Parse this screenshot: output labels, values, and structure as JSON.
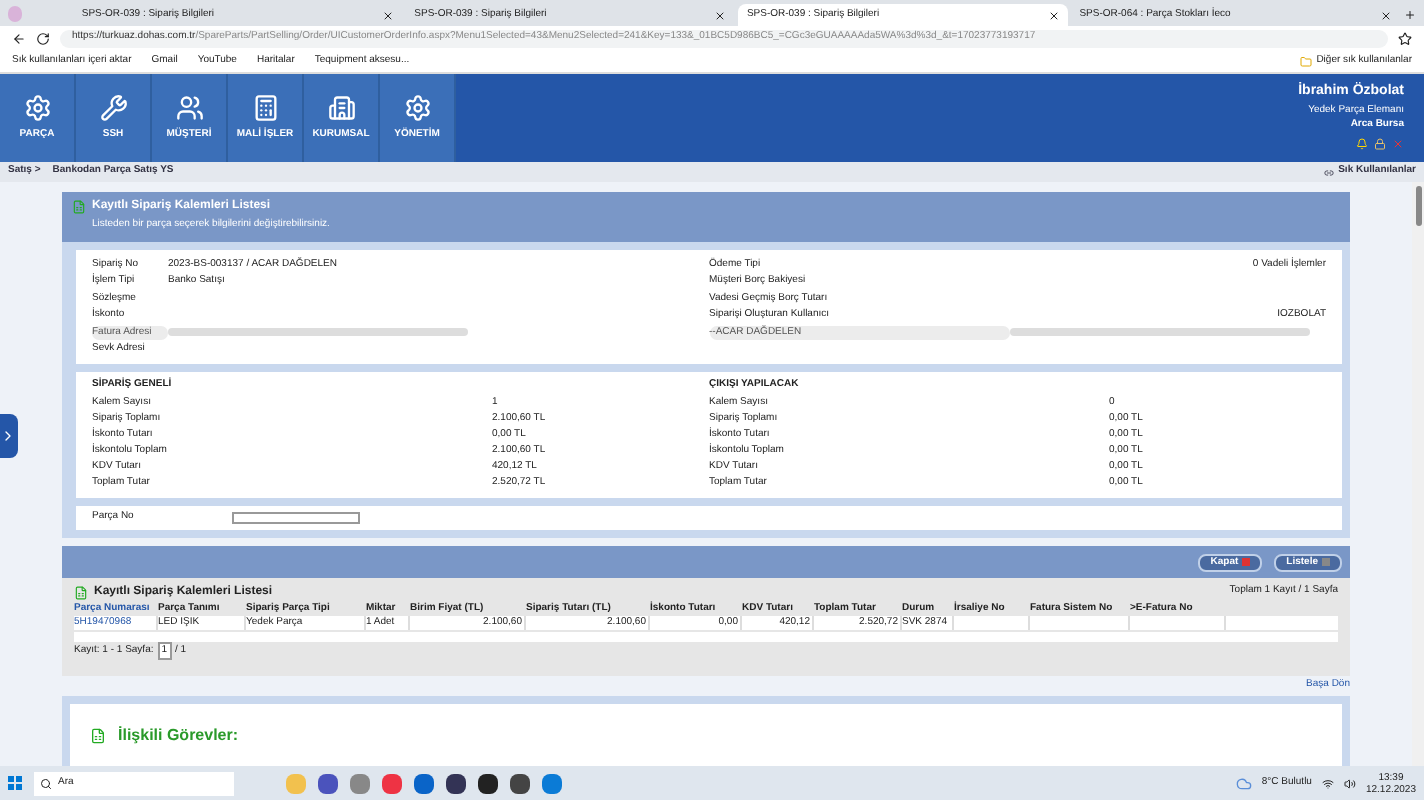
{
  "browser": {
    "tabs": [
      {
        "label": "SPS-OR-039 : Sipariş Bilgileri",
        "selected": false
      },
      {
        "label": "SPS-OR-039 : Sipariş Bilgileri",
        "selected": false
      },
      {
        "label": "SPS-OR-039 : Sipariş Bilgileri",
        "selected": true
      },
      {
        "label": "SPS-OR-064 : Parça Stokları İeco",
        "selected": false
      }
    ],
    "url_host": "https://turkuaz.dohas.com.tr",
    "url_path": "/SpareParts/PartSelling/Order/UICustomerOrderInfo.aspx?Menu1Selected=43&Menu2Selected=241&Key=133&_01BC5D986BC5_=CGc3eGUAAAAAda5WA%3d%3d_&t=17023773193717",
    "bookmarks": [
      "Sık kullanılanları içeri aktar",
      "Gmail",
      "YouTube",
      "Haritalar",
      "Tequipment aksesu..."
    ],
    "bookmarks_other": "Diğer sık kullanılanlar"
  },
  "nav": {
    "items": [
      "PARÇA",
      "SSH",
      "MÜŞTERİ",
      "MALİ İŞLER",
      "KURUMSAL",
      "YÖNETİM"
    ],
    "user": {
      "name": "İbrahim Özbolat",
      "role": "Yedek Parça Elemanı",
      "branch": "Arca Bursa"
    }
  },
  "breadcrumb": {
    "items": [
      "Satış >",
      "Bankodan Parça Satış YS"
    ],
    "favorites": "Sık Kullanılanlar"
  },
  "panel": {
    "title": "Kayıtlı Sipariş Kalemleri Listesi",
    "subtitle": "Listeden bir parça seçerek bilgilerini değiştirebilirsiniz."
  },
  "info": {
    "left": [
      {
        "label": "Sipariş No",
        "value": "2023-BS-003137 / ACAR DAĞDELEN",
        "blurred": false
      },
      {
        "label": "İşlem Tipi",
        "value": "Banko Satışı",
        "blurred": false
      },
      {
        "label": "Sözleşme",
        "blurred": false
      },
      {
        "label": "İskonto",
        "blurred": false
      },
      {
        "label": "Fatura Adresi",
        "blurred": true
      },
      {
        "label": "Sevk Adresi",
        "blurred": false
      }
    ],
    "right": [
      {
        "label": "Ödeme Tipi",
        "value": "0 Vadeli İşlemler",
        "blurred": false
      },
      {
        "label": "Müşteri Borç Bakiyesi",
        "blurred": false
      },
      {
        "label": "Vadesi Geçmiş Borç Tutarı",
        "blurred": false
      },
      {
        "label": "Siparişi Oluşturan Kullanıcı",
        "value": "IOZBOLAT",
        "blurred": false
      },
      {
        "label": "--ACAR DAĞDELEN",
        "blurred": true
      }
    ]
  },
  "summary": [
    {
      "title": "SİPARİŞ GENELİ",
      "rows": [
        {
          "label": "Kalem Sayısı",
          "value": "1"
        },
        {
          "label": "Sipariş Toplamı",
          "value": "2.100,60 TL"
        },
        {
          "label": "İskonto Tutarı",
          "value": "0,00 TL"
        },
        {
          "label": "İskontolu Toplam",
          "value": "2.100,60 TL"
        },
        {
          "label": "KDV Tutarı",
          "value": "420,12 TL"
        },
        {
          "label": "Toplam Tutar",
          "value": "2.520,72 TL"
        }
      ]
    },
    {
      "title": "ÇIKIŞI YAPILACAK",
      "rows": [
        {
          "label": "Kalem Sayısı",
          "value": "0"
        },
        {
          "label": "Sipariş Toplamı",
          "value": "0,00 TL"
        },
        {
          "label": "İskonto Tutarı",
          "value": "0,00 TL"
        },
        {
          "label": "İskontolu Toplam",
          "value": "0,00 TL"
        },
        {
          "label": "KDV Tutarı",
          "value": "0,00 TL"
        },
        {
          "label": "Toplam Tutar",
          "value": "0,00 TL"
        }
      ]
    }
  ],
  "part_filter": {
    "label": "Parça No"
  },
  "buttons": [
    "Kapat",
    "Listele"
  ],
  "table": {
    "title": "Kayıtlı Sipariş Kalemleri Listesi",
    "total": "Toplam 1 Kayıt / 1 Sayfa",
    "columns": [
      "Parça Numarası",
      "Parça Tanımı",
      "Sipariş Parça Tipi",
      "Miktar",
      "Birim Fiyat (TL)",
      "Sipariş Tutarı (TL)",
      "İskonto Tutarı",
      "KDV Tutarı",
      "Toplam Tutar",
      "Durum",
      "İrsaliye No",
      "Fatura Sistem No",
      ">E-Fatura No"
    ],
    "rows": [
      [
        "5H19470968",
        "LED IŞIK",
        "Yedek Parça",
        "1 Adet",
        "2.100,60",
        "2.100,60",
        "0,00",
        "420,12",
        "2.520,72",
        "SVK 2874",
        null,
        null,
        null
      ]
    ],
    "pager": {
      "label": "Kayıt: 1 - 1 Sayfa:",
      "page": "1",
      "of": "/ 1"
    }
  },
  "back_to_top": "Başa Dön",
  "related": {
    "title": "İlişkili Görevler:"
  },
  "taskbar": {
    "search": "Ara",
    "weather": "8°C Bulutlu",
    "time": "13:39",
    "date": "12.12.2023"
  }
}
